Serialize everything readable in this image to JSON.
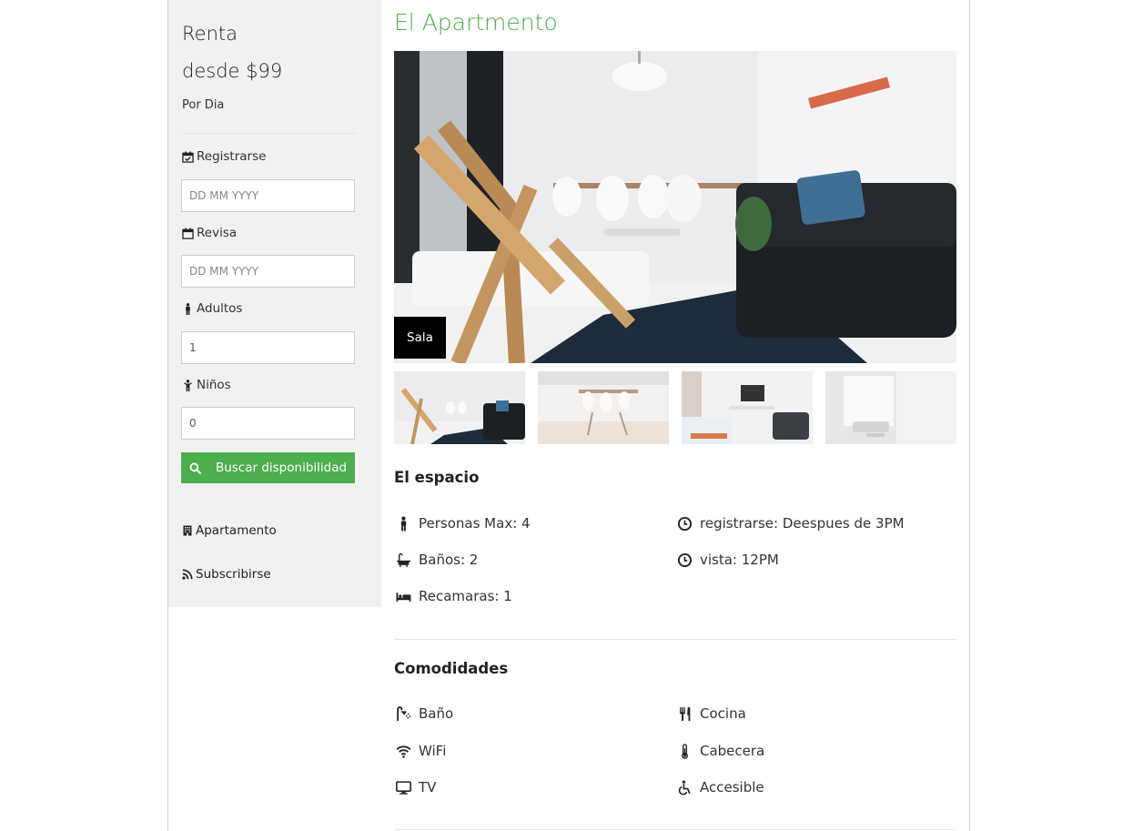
{
  "sidebar": {
    "renta": "Renta",
    "price": "desde $99",
    "per_day": "Por Dia",
    "checkin_label": "Registrarse",
    "checkin_placeholder": "DD MM YYYY",
    "checkout_label": "Revisa",
    "checkout_placeholder": "DD MM YYYY",
    "adults_label": "Adultos",
    "adults_value": "1",
    "children_label": "Niños",
    "children_value": "0",
    "search_button": "Buscar disponibilidad",
    "links": [
      {
        "label": "Apartamento",
        "icon": "building-icon"
      },
      {
        "label": "Subscribirse",
        "icon": "rss-icon"
      }
    ]
  },
  "main": {
    "title": "El Apartmento",
    "hero_caption": "Sala",
    "space": {
      "title": "El espacio",
      "left": [
        {
          "icon": "person-icon",
          "text": "Personas Max: 4"
        },
        {
          "icon": "bathtub-icon",
          "text": "Baños: 2"
        },
        {
          "icon": "bed-icon",
          "text": "Recamaras: 1"
        }
      ],
      "right": [
        {
          "icon": "clock-icon",
          "text": "registrarse: Deespues de 3PM"
        },
        {
          "icon": "clock-icon",
          "text": "vista: 12PM"
        }
      ]
    },
    "amenities": {
      "title": "Comodidades",
      "left": [
        {
          "icon": "shower-icon",
          "text": "Baño"
        },
        {
          "icon": "wifi-icon",
          "text": "WiFi"
        },
        {
          "icon": "tv-icon",
          "text": "TV"
        }
      ],
      "right": [
        {
          "icon": "cutlery-icon",
          "text": "Cocina"
        },
        {
          "icon": "thermometer-icon",
          "text": "Cabecera"
        },
        {
          "icon": "accessible-icon",
          "text": "Accesible"
        }
      ]
    }
  },
  "colors": {
    "accent": "#4cae4c",
    "sidebar_bg": "#f1f1f1"
  }
}
